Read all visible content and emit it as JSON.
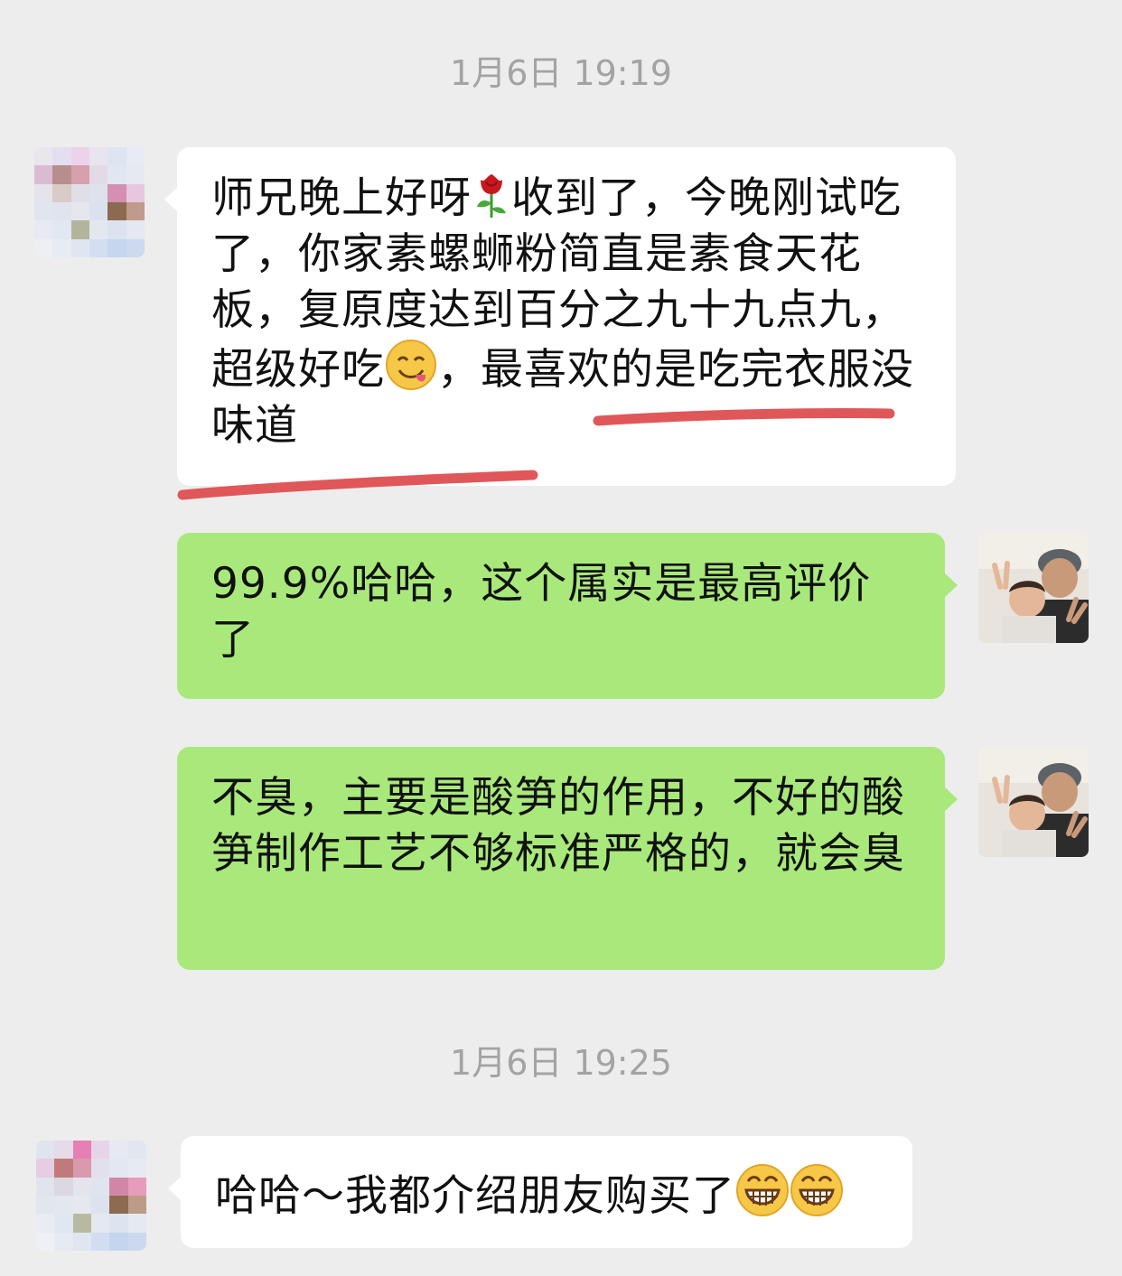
{
  "timestamps": [
    "1月6日 19:19",
    "1月6日 19:25"
  ],
  "messages": [
    {
      "side": "received",
      "text_before_rose": "师兄晚上好呀",
      "text_after_rose": "收到了，今晚刚试吃了，你家素螺蛳粉简直是素食天花板，复原度达到百分之九十九点九，超级好吃",
      "text_after_smile": "，最喜欢的是吃完衣服没味道",
      "emojis": [
        "rose-emoji",
        "savoring-food-emoji"
      ]
    },
    {
      "side": "sent",
      "text": "99.9%哈哈，这个属实是最高评价了"
    },
    {
      "side": "sent",
      "text": "不臭，主要是酸笋的作用，不好的酸笋制作工艺不够标准严格的，就会臭"
    },
    {
      "side": "received",
      "text": "哈哈～我都介绍朋友购买了",
      "emojis": [
        "grinning-emoji",
        "grinning-emoji"
      ]
    }
  ],
  "colors": {
    "background": "#ededed",
    "received_bubble": "#ffffff",
    "sent_bubble": "#a9e97b",
    "timestamp": "#a3a3a3",
    "highlight_underline": "#e0575a"
  },
  "icons": [
    "blurred-avatar",
    "user-avatar-photo",
    "rose-emoji",
    "savoring-food-emoji",
    "grinning-emoji"
  ]
}
